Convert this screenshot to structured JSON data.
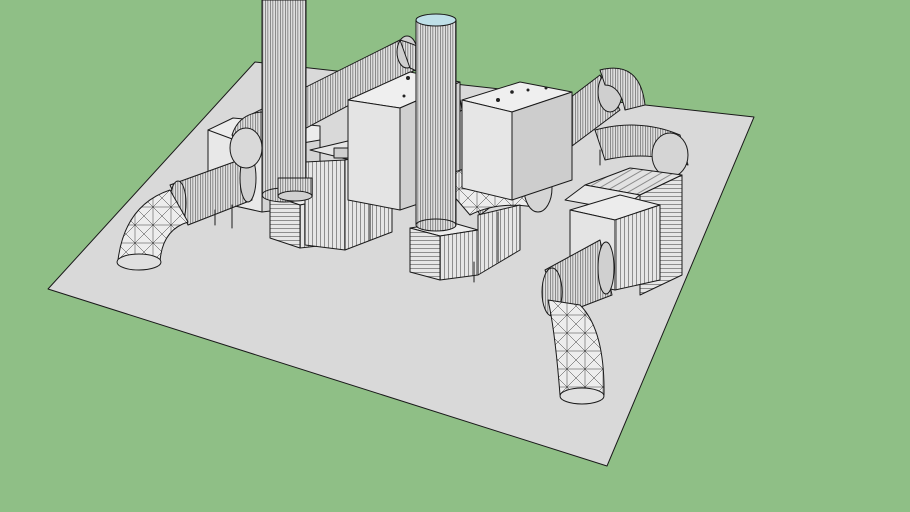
{
  "scene": {
    "background_color": "#8fbf86",
    "slab_color": "#d9d9d9",
    "box_color": "#e4e4e4",
    "pipe_color": "#dcdcdc",
    "line_color": "#1a1a1a"
  },
  "objects": {
    "slab": "concrete-slab",
    "stacks": [
      "stack-left",
      "stack-center"
    ],
    "ducts": [
      "duct-top-left",
      "duct-top-right",
      "elbow-left",
      "elbow-front-right"
    ],
    "units": [
      "unit-left",
      "unit-center",
      "unit-right",
      "fin-module-right"
    ]
  }
}
